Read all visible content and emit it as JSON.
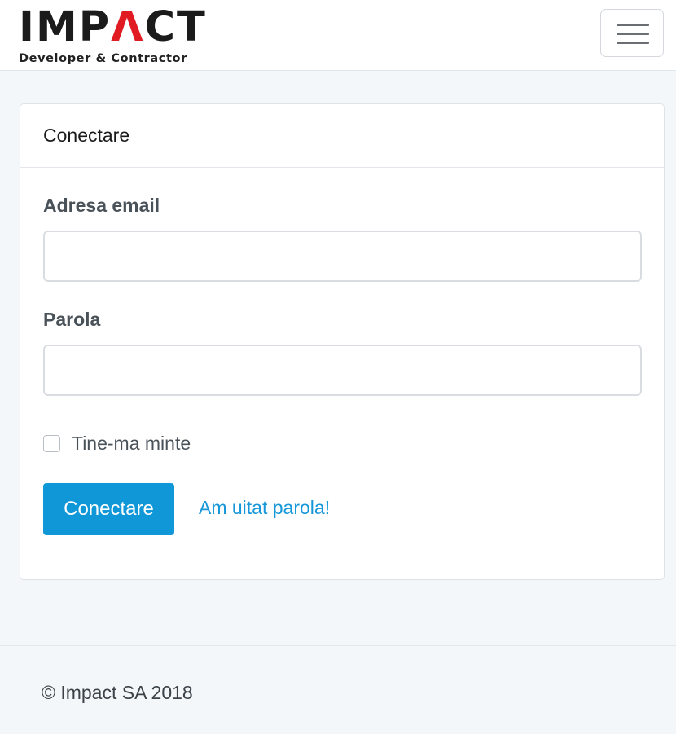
{
  "brand": {
    "logo_prefix": "IMP",
    "logo_accent": "Λ",
    "logo_suffix": "CT",
    "tagline": "Developer & Contractor",
    "accent_color": "#e11b22"
  },
  "navbar": {
    "toggle_icon": "hamburger-menu-icon"
  },
  "login_card": {
    "title": "Conectare",
    "email_label": "Adresa email",
    "email_value": "",
    "password_label": "Parola",
    "password_value": "",
    "remember_label": "Tine-ma minte",
    "remember_checked": false,
    "submit_label": "Conectare",
    "forgot_label": "Am uitat parola!",
    "primary_color": "#1097d8"
  },
  "footer": {
    "copyright": "© Impact SA 2018"
  }
}
